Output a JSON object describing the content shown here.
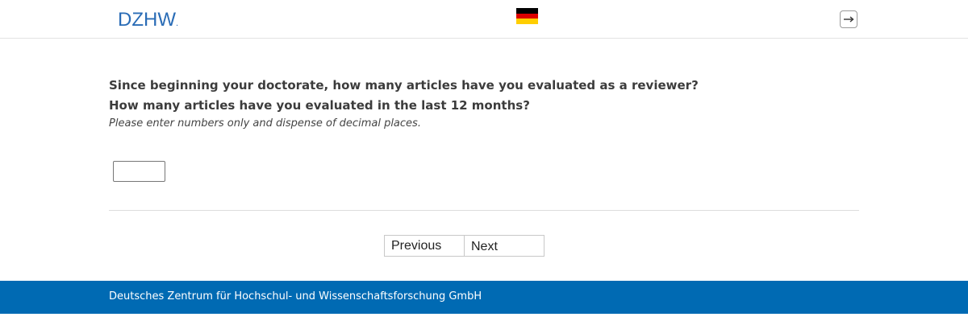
{
  "header": {
    "logo_text": "DZHW",
    "logo_dot": ".",
    "language_flag": {
      "icon": "german-flag-icon",
      "colors": [
        "#000000",
        "#dd0000",
        "#ffce00"
      ]
    },
    "logout_icon": "logout-icon"
  },
  "question": {
    "line1": "Since beginning your doctorate, how many articles have you evaluated as a reviewer?",
    "line2": "How many articles have you evaluated in the last 12 months?",
    "hint": "Please enter numbers only and dispense of decimal places.",
    "input_value": ""
  },
  "navigation": {
    "previous_label": "Previous",
    "next_label": "Next"
  },
  "footer": {
    "text": "Deutsches Zentrum für Hochschul- und Wissenschaftsforschung GmbH",
    "background": "#006ab3"
  },
  "colors": {
    "brand_blue": "#2a6cb6",
    "footer_blue": "#006ab3"
  }
}
